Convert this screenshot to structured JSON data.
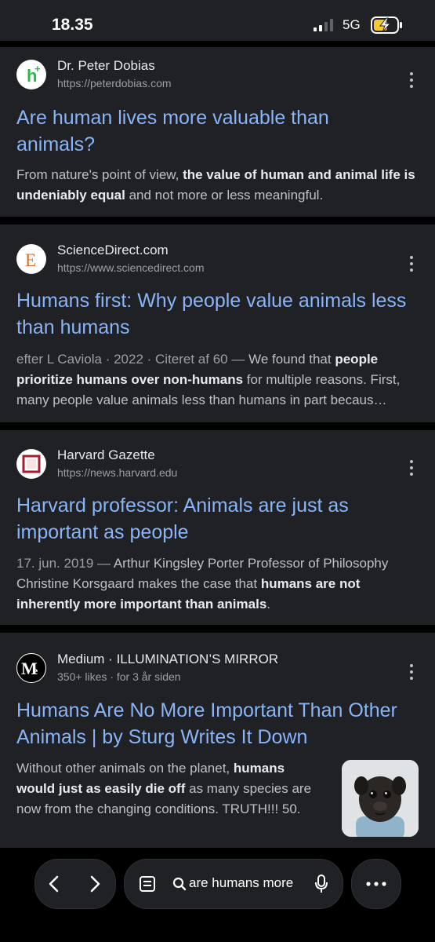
{
  "status": {
    "time": "18.35",
    "network": "5G"
  },
  "results": [
    {
      "site": "Dr. Peter Dobias",
      "url": "https://peterdobias.com",
      "favicon_letter": "h",
      "title_line1": "Are human lives more valuable than",
      "title_line2": "animals?",
      "snippet": [
        {
          "text": "From nature's point of view, ",
          "bold": false
        },
        {
          "text": "the value of human and animal life is undeniably equal",
          "bold": true
        },
        {
          "text": " and not more or less meaningful.",
          "bold": false
        }
      ]
    },
    {
      "site": "ScienceDirect.com",
      "url": "https://www.sciencedirect.com",
      "favicon_letter": "E",
      "title_line1": "Humans first: Why people value animals less",
      "title_line2": "than humans",
      "snippet_date": "efter L Caviola · 2022 · Citeret af 60 — ",
      "snippet": [
        {
          "text": "We found that ",
          "bold": false
        },
        {
          "text": "people prioritize humans over non-humans",
          "bold": true
        },
        {
          "text": " for multiple reasons. First, many people value animals less than humans in part becaus…",
          "bold": false
        }
      ]
    },
    {
      "site": "Harvard Gazette",
      "url": "https://news.harvard.edu",
      "title_line1": "Harvard professor: Animals are just as",
      "title_line2": "important as people",
      "snippet_date": "17. jun. 2019 — ",
      "snippet": [
        {
          "text": "Arthur Kingsley Porter Professor of Philosophy Christine Korsgaard makes the case that ",
          "bold": false
        },
        {
          "text": "humans are not inherently more important than animals",
          "bold": true
        },
        {
          "text": ".",
          "bold": false
        }
      ]
    },
    {
      "site": "Medium · ILLUMINATION’S MIRROR",
      "meta": "350+ likes · for 3 år siden",
      "favicon_letter": "M",
      "title_line1": "Humans Are No More Important Than Other",
      "title_line2": "Animals | by Sturg Writes It Down",
      "snippet": [
        {
          "text": "Without other animals on the planet, ",
          "bold": false
        },
        {
          "text": "humans would just as easily die off",
          "bold": true
        },
        {
          "text": " as many species are now from the changing conditions. TRUTH!!! 50.",
          "bold": false
        }
      ]
    }
  ],
  "bottom_bar": {
    "search_text": "are humans more"
  },
  "colors": {
    "link": "#8ab4f8",
    "card": "#202124",
    "background": "#000000"
  }
}
